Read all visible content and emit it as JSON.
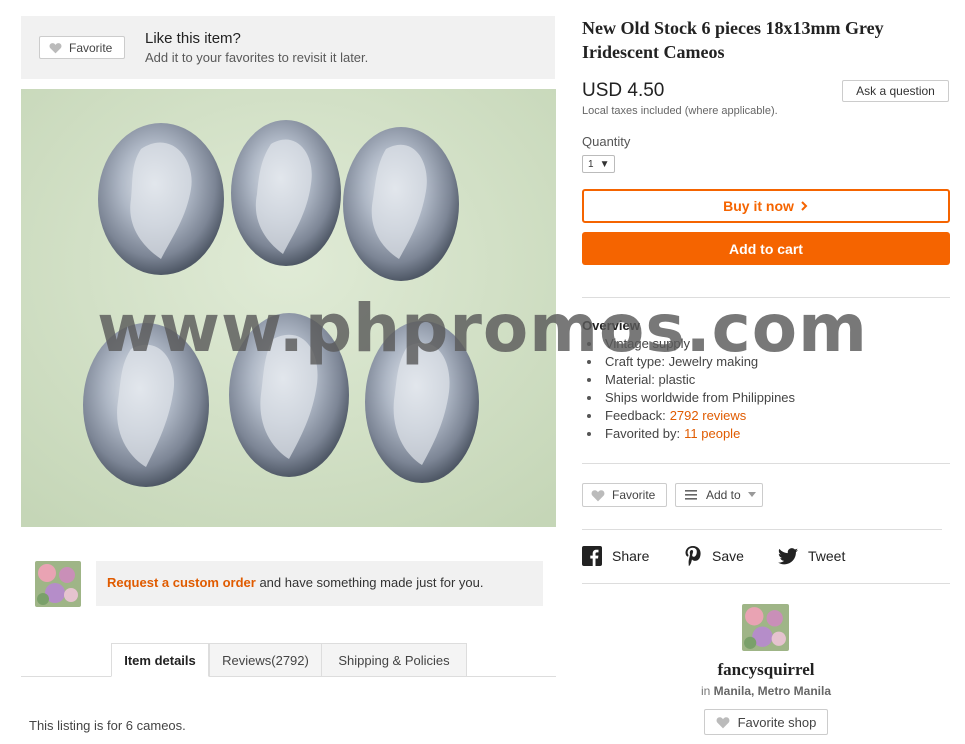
{
  "favorite_banner": {
    "button_label": "Favorite",
    "title": "Like this item?",
    "subtitle": "Add it to your favorites to revisit it later."
  },
  "listing": {
    "title": "New Old Stock 6 pieces 18x13mm Grey Iridescent Cameos",
    "price": "USD 4.50",
    "ask_label": "Ask a question",
    "tax_note": "Local taxes included (where applicable).",
    "quantity_label": "Quantity",
    "quantity_value": "1",
    "buy_now_label": "Buy it now",
    "add_to_cart_label": "Add to cart"
  },
  "overview": {
    "heading": "Overview",
    "items": [
      {
        "label": "Vintage supply",
        "link": ""
      },
      {
        "label": "Craft type: Jewelry making",
        "link": ""
      },
      {
        "label": "Material: plastic",
        "link": ""
      },
      {
        "label": "Ships worldwide from Philippines",
        "link": ""
      },
      {
        "label": "Feedback:",
        "link": "2792 reviews"
      },
      {
        "label": "Favorited by:",
        "link": "11 people"
      }
    ]
  },
  "actions": {
    "favorite_label": "Favorite",
    "add_to_label": "Add to"
  },
  "share": {
    "facebook_label": "Share",
    "pinterest_label": "Save",
    "twitter_label": "Tweet"
  },
  "shop": {
    "name": "fancysquirrel",
    "location_prefix": "in",
    "location": "Manila, Metro Manila",
    "favorite_label": "Favorite shop"
  },
  "custom_order": {
    "link": "Request a custom order",
    "text": " and have something made just for you."
  },
  "tabs": [
    {
      "label": "Item details",
      "active": true
    },
    {
      "label": "Reviews(2792)",
      "active": false
    },
    {
      "label": "Shipping & Policies",
      "active": false
    }
  ],
  "description": "This listing is for 6 cameos.",
  "watermark": "www.phpromos.com",
  "colors": {
    "accent": "#f56400",
    "link": "#e05b00",
    "banner_bg": "#f1f1f1"
  }
}
